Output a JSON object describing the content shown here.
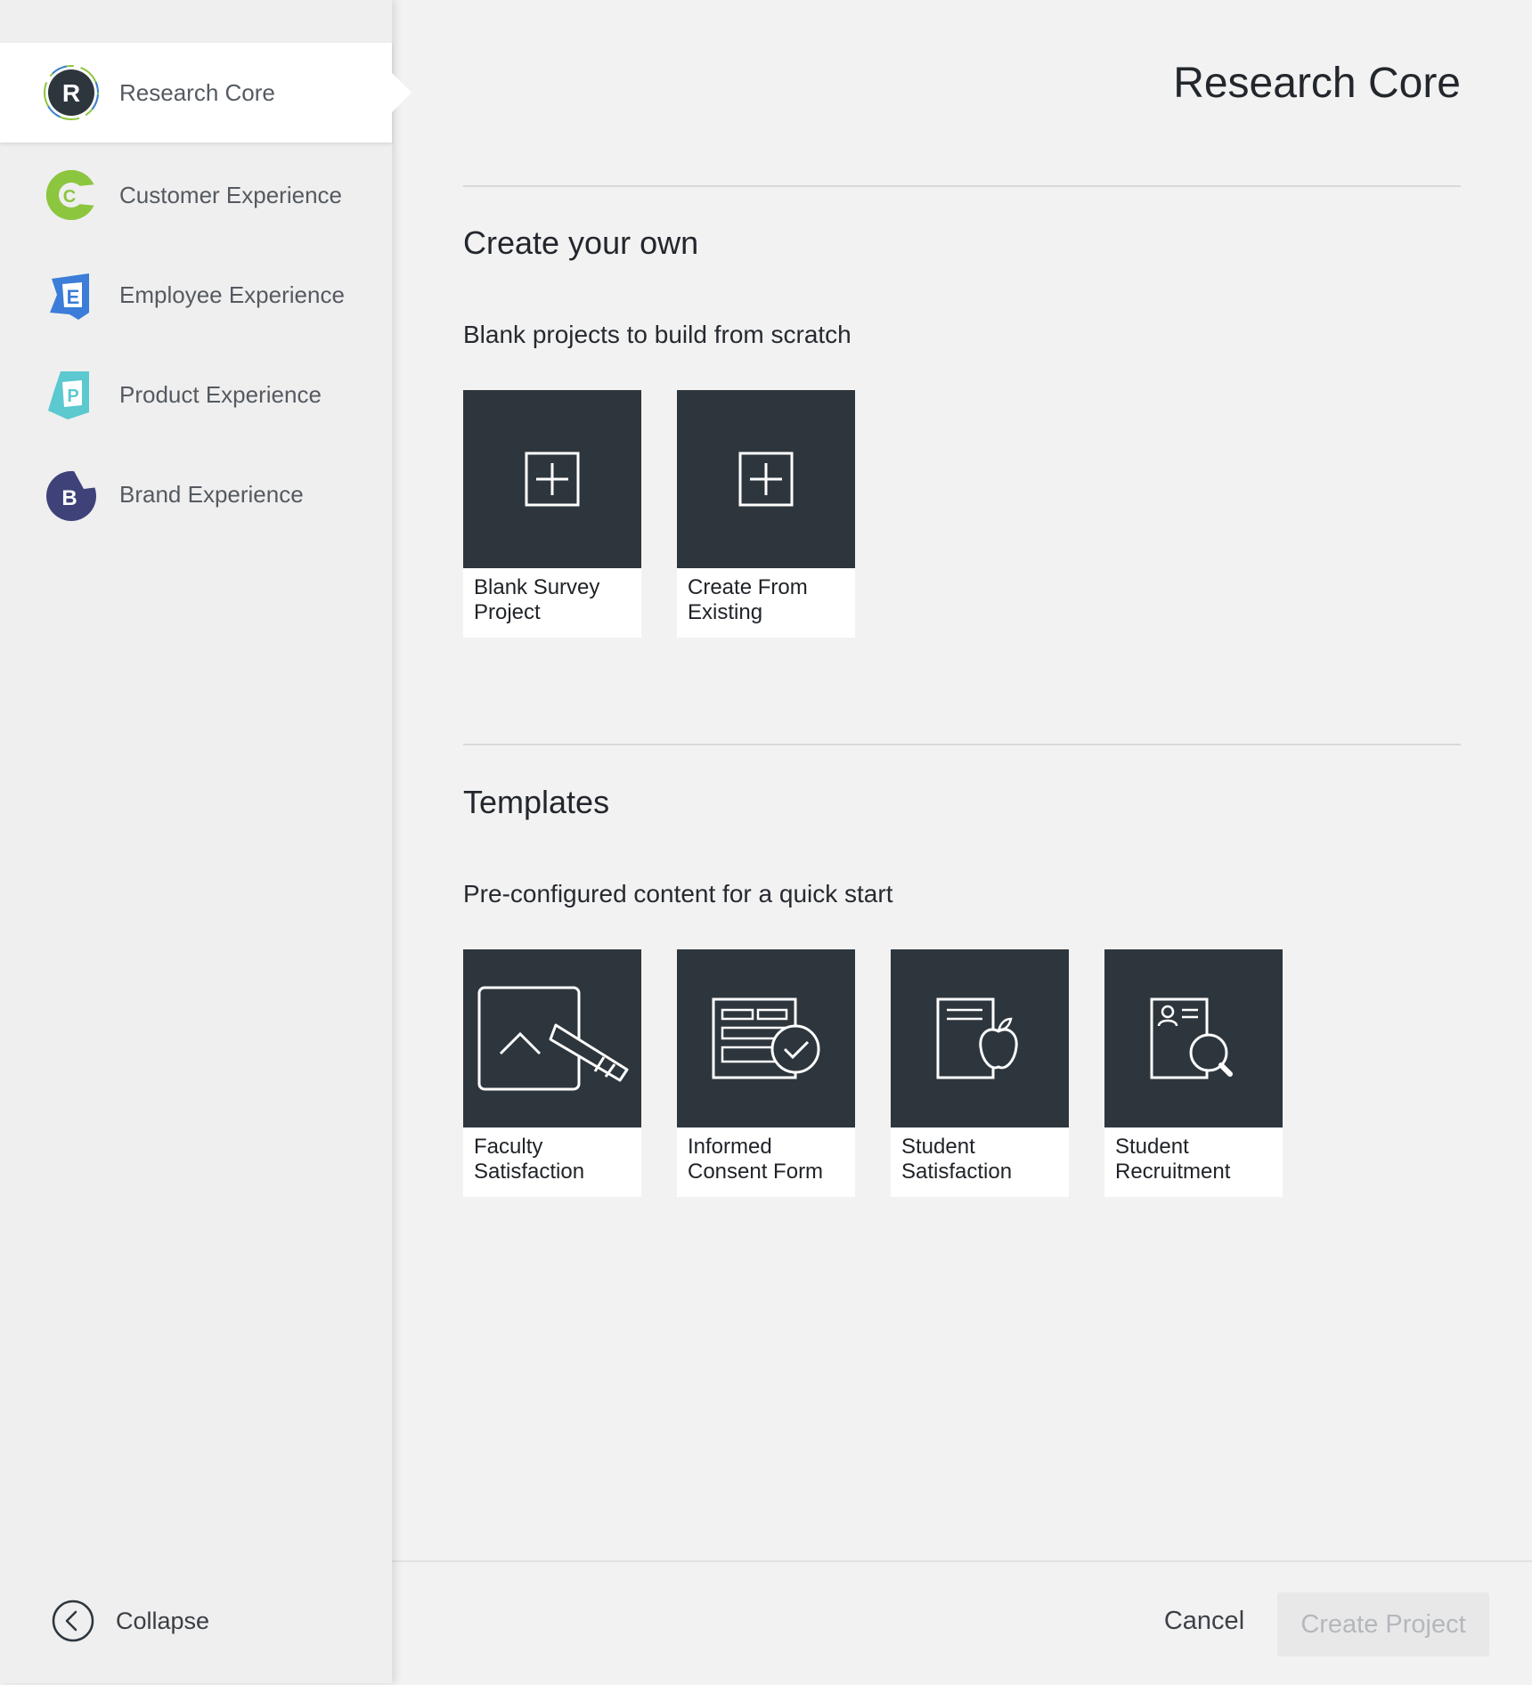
{
  "sidebar": {
    "items": [
      {
        "label": "Research Core",
        "letter": "R",
        "icon": "research-core-icon",
        "active": true
      },
      {
        "label": "Customer Experience",
        "letter": "C",
        "icon": "customer-experience-icon",
        "color": "#8cc63f"
      },
      {
        "label": "Employee Experience",
        "letter": "E",
        "icon": "employee-experience-icon",
        "color": "#3b7dd8"
      },
      {
        "label": "Product Experience",
        "letter": "P",
        "icon": "product-experience-icon",
        "color": "#5cc8d0"
      },
      {
        "label": "Brand Experience",
        "letter": "B",
        "icon": "brand-experience-icon",
        "color": "#3f4279"
      }
    ],
    "collapse_label": "Collapse"
  },
  "main": {
    "title": "Research Core",
    "create_section": {
      "title": "Create your own",
      "subtitle": "Blank projects to build from scratch",
      "cards": [
        {
          "label": "Blank Survey Project",
          "icon": "plus-square-icon"
        },
        {
          "label": "Create From Existing",
          "icon": "plus-square-icon"
        }
      ]
    },
    "templates_section": {
      "title": "Templates",
      "subtitle": "Pre-configured content for a quick start",
      "cards": [
        {
          "label": "Faculty Satisfaction",
          "icon": "checkmark-pencil-icon"
        },
        {
          "label": "Informed Consent Form",
          "icon": "form-check-icon"
        },
        {
          "label": "Student Satisfaction",
          "icon": "paper-apple-icon"
        },
        {
          "label": "Student Recruitment",
          "icon": "profile-search-icon"
        }
      ]
    }
  },
  "footer": {
    "cancel_label": "Cancel",
    "create_label": "Create Project"
  },
  "colors": {
    "thumb_bg": "#2e363d",
    "page_bg": "#f2f2f2",
    "create_button_disabled": "#e8e8e8"
  }
}
